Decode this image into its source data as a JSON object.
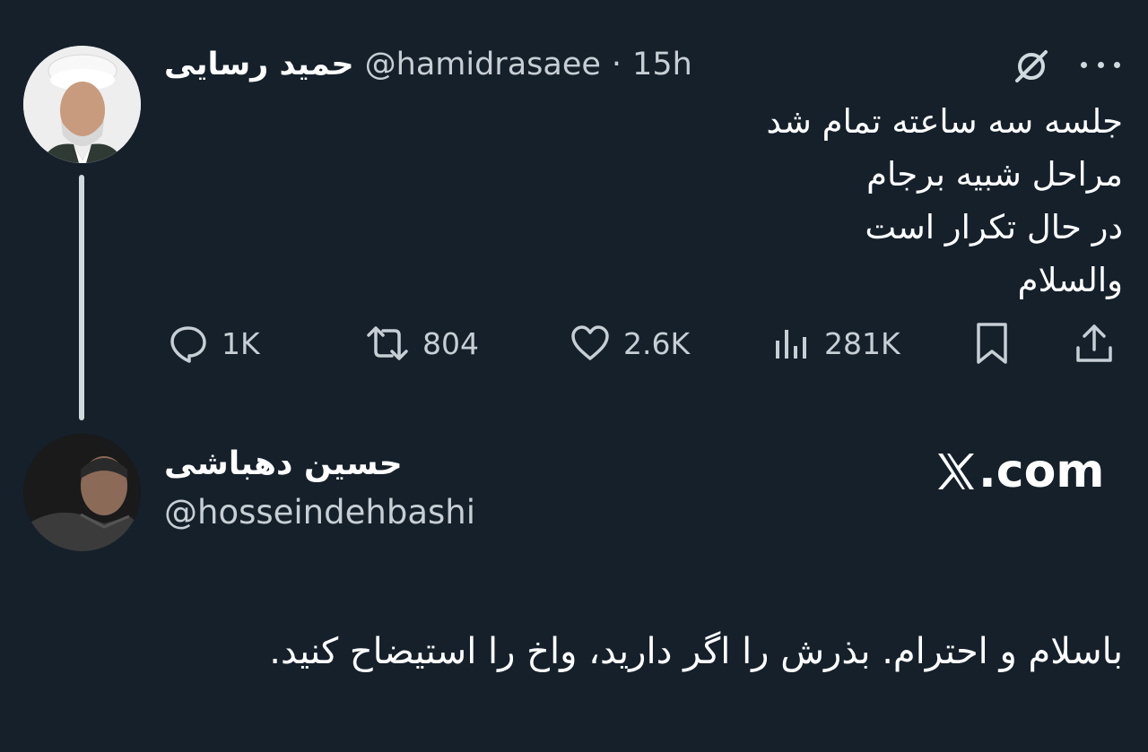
{
  "tweet": {
    "author_name": "حمید رسایی",
    "author_handle": "@hamidrasaee",
    "separator": "·",
    "time": "15h",
    "lines": [
      "جلسه سه ساعته تمام شد",
      "مراحل شبیه برجام",
      "در حال تکرار است",
      "والسلام"
    ],
    "actions": {
      "replies": "1K",
      "reposts": "804",
      "likes": "2.6K",
      "views": "281K"
    }
  },
  "reply": {
    "author_name": "حسین دهباشی",
    "author_handle": "@hosseindehbashi",
    "text": "باسلام و احترام. بذرش را اگر دارید، واخ را استیضاح کنید."
  },
  "brand": {
    "text": ".com"
  },
  "icons": {
    "grok": "grok-icon",
    "more": "more-icon",
    "reply": "reply-icon",
    "repost": "repost-icon",
    "like": "heart-icon",
    "views": "views-icon",
    "bookmark": "bookmark-icon",
    "share": "share-icon",
    "x_logo": "x-logo-icon"
  },
  "colors": {
    "background": "#15202b",
    "text": "#ffffff",
    "muted": "#c7ced4"
  }
}
